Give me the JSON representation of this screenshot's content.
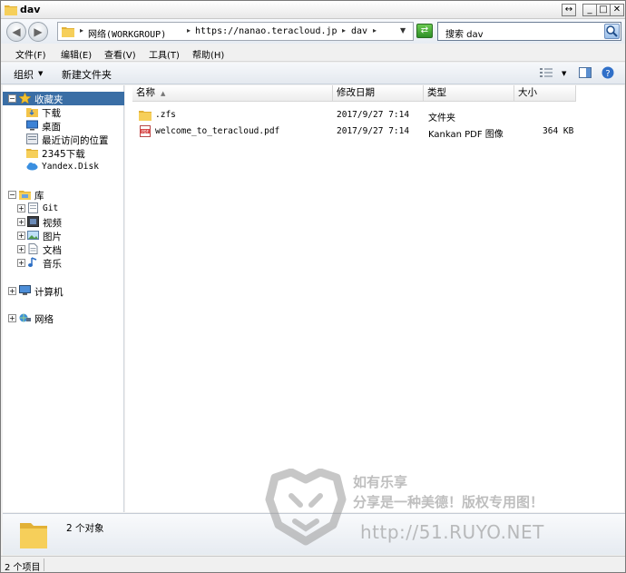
{
  "window": {
    "title": "dav"
  },
  "address": {
    "crumbs": [
      "网络(WORKGROUP)",
      "https://nanao.teracloud.jp",
      "dav"
    ]
  },
  "search": {
    "placeholder": "搜索 dav"
  },
  "menu": [
    "文件(F)",
    "编辑(E)",
    "查看(V)",
    "工具(T)",
    "帮助(H)"
  ],
  "commands": {
    "organize": "组织",
    "new_folder": "新建文件夹"
  },
  "nav": {
    "favorites": "收藏夹",
    "favorites_items": [
      "下载",
      "桌面",
      "最近访问的位置",
      "2345下载",
      "Yandex.Disk"
    ],
    "libraries": "库",
    "library_items": [
      "Git",
      "视频",
      "图片",
      "文档",
      "音乐"
    ],
    "computer": "计算机",
    "network": "网络"
  },
  "columns": {
    "name": "名称",
    "date": "修改日期",
    "type": "类型",
    "size": "大小"
  },
  "files": [
    {
      "name": ".zfs",
      "date": "2017/9/27 7:14",
      "type": "文件夹",
      "size": ""
    },
    {
      "name": "welcome_to_teracloud.pdf",
      "date": "2017/9/27 7:14",
      "type": "Kankan PDF 图像",
      "size": "364 KB"
    }
  ],
  "details": {
    "count": "2 个对象"
  },
  "status": {
    "text": "2 个项目"
  },
  "watermark": {
    "line1": "如有乐享",
    "line2": "分享是一种美德！版权专用图！",
    "url": "http://51.RUYO.NET"
  },
  "colors": {
    "selection": "#3a6ea5",
    "folder": "#f3c44a",
    "window_bg": "#f0f0f0"
  }
}
